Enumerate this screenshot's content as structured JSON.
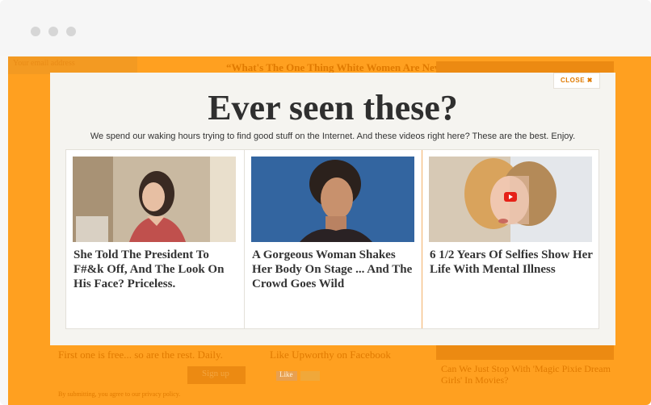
{
  "background": {
    "headline": "“What's The One Thing White Women Are Never",
    "newsletter_text": "First one is free... so are the rest. Daily.",
    "email_placeholder": "Your email address",
    "signup_label": "Sign up",
    "like_text": "Like Upworthy on Facebook",
    "fb_like": "Like",
    "side_link": "Can We Just Stop With 'Magic Pixie Dream Girls' In Movies?",
    "fine_print": "By submitting, you agree to our privacy policy."
  },
  "modal": {
    "close_label": "CLOSE ✖",
    "title": "Ever seen these?",
    "subtitle": "We spend our waking hours trying to find good stuff on the Internet. And these videos right here? These are the best. Enjoy.",
    "cards": [
      {
        "title": "She Told The President To F#&k Off, And The Look On His Face? Priceless."
      },
      {
        "title": "A Gorgeous Woman Shakes Her Body On Stage ... And The Crowd Goes Wild"
      },
      {
        "title": "6 1/2 Years Of Selfies Show Her Life With Mental Illness"
      }
    ]
  },
  "colors": {
    "page_background": "#ffa020",
    "accent": "#e07a00",
    "modal_background": "#f5f4f0",
    "title": "#2f2f2f"
  },
  "icons": {
    "play": "play-icon",
    "close": "close-icon"
  }
}
